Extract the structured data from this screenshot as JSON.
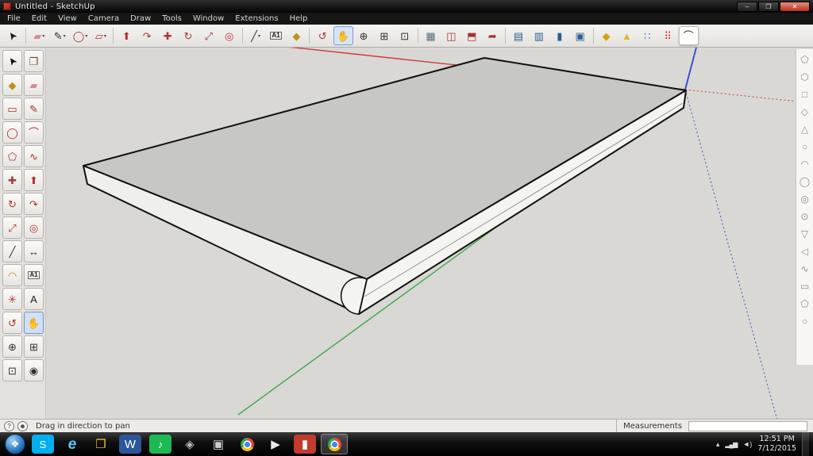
{
  "window": {
    "title": "Untitled - SketchUp",
    "minimize": "–",
    "maximize": "❐",
    "close": "✕"
  },
  "menu_bar": {
    "items": [
      {
        "name": "menu-file",
        "label": "File"
      },
      {
        "name": "menu-edit",
        "label": "Edit"
      },
      {
        "name": "menu-view",
        "label": "View"
      },
      {
        "name": "menu-camera",
        "label": "Camera"
      },
      {
        "name": "menu-draw",
        "label": "Draw"
      },
      {
        "name": "menu-tools",
        "label": "Tools"
      },
      {
        "name": "menu-window",
        "label": "Window"
      },
      {
        "name": "menu-extensions",
        "label": "Extensions"
      },
      {
        "name": "menu-help",
        "label": "Help"
      }
    ]
  },
  "top_toolbar": {
    "items": [
      {
        "name": "select-tool",
        "glyph": "➤",
        "color": "#1a1a1a",
        "cls": "rot-nw"
      },
      {
        "name": "toolbar-separator",
        "cls": "sep",
        "interactable": false
      },
      {
        "name": "eraser-tool",
        "glyph": "▰",
        "color": "#cf8d8d",
        "caret": "▾"
      },
      {
        "name": "line-tool",
        "glyph": "✎",
        "color": "#333333",
        "caret": "▾"
      },
      {
        "name": "shapes-tool",
        "glyph": "◯",
        "color": "#a63232",
        "caret": "▾"
      },
      {
        "name": "rotated-rectangle-tool",
        "glyph": "▱",
        "color": "#a63232",
        "caret": "▾"
      },
      {
        "name": "toolbar-separator",
        "cls": "sep",
        "interactable": false
      },
      {
        "name": "push-pull-tool",
        "glyph": "⬆",
        "color": "#b03434"
      },
      {
        "name": "follow-me-tool",
        "glyph": "↷",
        "color": "#b03434"
      },
      {
        "name": "move-tool",
        "glyph": "✚",
        "color": "#b03434"
      },
      {
        "name": "rotate-tool",
        "glyph": "↻",
        "color": "#b03434"
      },
      {
        "name": "scale-tool",
        "glyph": "⤢",
        "color": "#b03434"
      },
      {
        "name": "offset-tool",
        "glyph": "◎",
        "color": "#b03434"
      },
      {
        "name": "toolbar-separator",
        "cls": "sep",
        "interactable": false
      },
      {
        "name": "tape-measure-tool",
        "glyph": "╱",
        "color": "#333333",
        "caret": "▾"
      },
      {
        "name": "text-tool",
        "glyph": "A1",
        "color": "#222222",
        "cls": "small-text"
      },
      {
        "name": "paint-bucket-tool",
        "glyph": "◆",
        "color": "#c09020"
      },
      {
        "name": "toolbar-separator",
        "cls": "sep",
        "interactable": false
      },
      {
        "name": "orbit-tool",
        "glyph": "↺",
        "color": "#b03434"
      },
      {
        "name": "pan-tool",
        "glyph": "✋",
        "color": "#bf9268",
        "selected": true
      },
      {
        "name": "zoom-tool",
        "glyph": "⊕",
        "color": "#333333"
      },
      {
        "name": "zoom-window-tool",
        "glyph": "⊞",
        "color": "#333333"
      },
      {
        "name": "zoom-extents-tool",
        "glyph": "⊡",
        "color": "#333333"
      },
      {
        "name": "toolbar-separator",
        "cls": "sep",
        "interactable": false
      },
      {
        "name": "section-plane-tool",
        "glyph": "▦",
        "color": "#5a6b7a"
      },
      {
        "name": "section-display-toggle",
        "glyph": "◫",
        "color": "#a63232"
      },
      {
        "name": "section-cut-toggle",
        "glyph": "⬒",
        "color": "#a63232"
      },
      {
        "name": "export-scene-button",
        "glyph": "➦",
        "color": "#a63232"
      },
      {
        "name": "toolbar-separator",
        "cls": "sep",
        "interactable": false
      },
      {
        "name": "style-wireframe-button",
        "glyph": "▤",
        "color": "#2b5f8f"
      },
      {
        "name": "style-hidden-line-button",
        "glyph": "▥",
        "color": "#2b5f8f"
      },
      {
        "name": "style-shaded-button",
        "glyph": "▮",
        "color": "#2b5f8f"
      },
      {
        "name": "style-textured-button",
        "glyph": "▣",
        "color": "#2b5f8f"
      },
      {
        "name": "toolbar-separator",
        "cls": "sep",
        "interactable": false
      },
      {
        "name": "shadows-toggle",
        "glyph": "◆",
        "color": "#d4a017"
      },
      {
        "name": "fog-toggle",
        "glyph": "▲",
        "color": "#e0b52a"
      },
      {
        "name": "components-browser-button",
        "glyph": "∷",
        "color": "#3367d6"
      },
      {
        "name": "colors-browser-button",
        "glyph": "⠿",
        "color": "#d63333"
      },
      {
        "name": "two-point-arc-tool",
        "glyph": "⌒",
        "color": "#333333",
        "cls": "float-tool"
      }
    ]
  },
  "left_toolbar": {
    "items": [
      {
        "name": "select-tool",
        "glyph": "➤",
        "color": "#111111",
        "cls": "rot-nw"
      },
      {
        "name": "make-component-tool",
        "glyph": "❐",
        "color": "#6b4a2a"
      },
      {
        "name": "paint-bucket-tool",
        "glyph": "◆",
        "color": "#c09020"
      },
      {
        "name": "eraser-tool",
        "glyph": "▰",
        "color": "#cf8d8d"
      },
      {
        "name": "rectangle-tool",
        "glyph": "▭",
        "color": "#a63232"
      },
      {
        "name": "line-tool",
        "glyph": "✎",
        "color": "#a63232"
      },
      {
        "name": "circle-tool",
        "glyph": "◯",
        "color": "#a63232"
      },
      {
        "name": "arc-tool",
        "glyph": "⌒",
        "color": "#a63232"
      },
      {
        "name": "polygon-tool",
        "glyph": "⬠",
        "color": "#a63232"
      },
      {
        "name": "freehand-tool",
        "glyph": "∿",
        "color": "#a63232"
      },
      {
        "name": "move-tool",
        "glyph": "✚",
        "color": "#b03434"
      },
      {
        "name": "push-pull-tool",
        "glyph": "⬆",
        "color": "#b03434"
      },
      {
        "name": "rotate-tool",
        "glyph": "↻",
        "color": "#b03434"
      },
      {
        "name": "follow-me-tool",
        "glyph": "↷",
        "color": "#b03434"
      },
      {
        "name": "scale-tool",
        "glyph": "⤢",
        "color": "#b03434"
      },
      {
        "name": "offset-tool",
        "glyph": "◎",
        "color": "#b03434"
      },
      {
        "name": "tape-measure-tool",
        "glyph": "╱",
        "color": "#333333"
      },
      {
        "name": "dimension-tool",
        "glyph": "↔",
        "color": "#333333"
      },
      {
        "name": "protractor-tool",
        "glyph": "◠",
        "color": "#c09020"
      },
      {
        "name": "text-tool",
        "glyph": "A1",
        "color": "#222222",
        "cls": "small-text"
      },
      {
        "name": "axes-tool",
        "glyph": "✳",
        "color": "#b03434"
      },
      {
        "name": "3d-text-tool",
        "glyph": "A",
        "color": "#222222"
      },
      {
        "name": "orbit-tool",
        "glyph": "↺",
        "color": "#b03434"
      },
      {
        "name": "pan-tool",
        "glyph": "✋",
        "color": "#bf9268",
        "selected": true
      },
      {
        "name": "zoom-tool",
        "glyph": "⊕",
        "color": "#333333"
      },
      {
        "name": "zoom-window-tool",
        "glyph": "⊞",
        "color": "#333333"
      },
      {
        "name": "zoom-extents-tool",
        "glyph": "⊡",
        "color": "#333333"
      },
      {
        "name": "look-around-tool",
        "glyph": "◉",
        "color": "#333333"
      }
    ]
  },
  "right_toolbar": {
    "items": [
      {
        "name": "shape-pentagon-icon",
        "glyph": "⬠",
        "color": "#90908c"
      },
      {
        "name": "shape-hexagon-icon",
        "glyph": "⬡",
        "color": "#90908c"
      },
      {
        "name": "shape-cube-icon",
        "glyph": "□",
        "color": "#90908c"
      },
      {
        "name": "shape-prism-icon",
        "glyph": "◇",
        "color": "#90908c"
      },
      {
        "name": "shape-cone-icon",
        "glyph": "△",
        "color": "#90908c"
      },
      {
        "name": "shape-sphere-icon",
        "glyph": "○",
        "color": "#90908c"
      },
      {
        "name": "shape-dome-icon",
        "glyph": "◠",
        "color": "#90908c"
      },
      {
        "name": "shape-cylinder-icon",
        "glyph": "◯",
        "color": "#90908c"
      },
      {
        "name": "shape-torus-icon",
        "glyph": "◎",
        "color": "#90908c"
      },
      {
        "name": "shape-tube-icon",
        "glyph": "⊙",
        "color": "#90908c"
      },
      {
        "name": "shape-pyramid-icon",
        "glyph": "▽",
        "color": "#90908c"
      },
      {
        "name": "shape-wedge-icon",
        "glyph": "◁",
        "color": "#90908c"
      },
      {
        "name": "shape-helix-icon",
        "glyph": "∿",
        "color": "#90908c"
      },
      {
        "name": "shape-box-icon",
        "glyph": "▭",
        "color": "#90908c"
      },
      {
        "name": "shape-polygon-icon",
        "glyph": "⬠",
        "color": "#90908c"
      },
      {
        "name": "shape-ellipse-icon",
        "glyph": "○",
        "color": "#90908c"
      }
    ]
  },
  "viewport": {
    "axis_colors": {
      "red": "#cf3a3a",
      "green": "#3fa74a",
      "blue": "#3953c9"
    },
    "model": {
      "top_face_color": "#c7c7c3",
      "front_face_color": "#f4f4f1",
      "left_face_color": "#efefec"
    }
  },
  "status_bar": {
    "help": "?",
    "user": "☻",
    "hint": "Drag in direction to pan",
    "measurements_label": "Measurements",
    "measurements_value": ""
  },
  "taskbar": {
    "start": "❖",
    "apps": [
      {
        "name": "taskbar-app-skype",
        "glyph": "S",
        "bg": "#00aff0",
        "color": "#ffffff",
        "cls": "round"
      },
      {
        "name": "taskbar-app-internet-explorer",
        "glyph": "e",
        "color": "#5fc8f5",
        "cls": "app-ie"
      },
      {
        "name": "taskbar-app-file-explorer",
        "glyph": "❐",
        "color": "#f7c64a"
      },
      {
        "name": "taskbar-app-word",
        "glyph": "W",
        "bg": "#2b579a",
        "color": "#ffffff"
      },
      {
        "name": "taskbar-app-spotify",
        "glyph": "♪",
        "bg": "#1db954",
        "color": "#ffffff",
        "cls": "round"
      },
      {
        "name": "taskbar-app-screenshot-tool",
        "glyph": "◈",
        "color": "#b9b9b9"
      },
      {
        "name": "taskbar-app-media-player",
        "glyph": "▣",
        "color": "#cfcfcf"
      },
      {
        "name": "taskbar-app-chrome",
        "glyph": "",
        "cls": "app-chrome"
      },
      {
        "name": "taskbar-app-video-player",
        "glyph": "▶",
        "color": "#e8e8e8"
      },
      {
        "name": "taskbar-app-photo-viewer",
        "glyph": "▮",
        "bg": "#c13b2e",
        "color": "#ffffff"
      },
      {
        "name": "taskbar-app-chrome-active",
        "glyph": "",
        "cls": "app-chrome active"
      }
    ],
    "tray": {
      "overflow": "▴",
      "network": "▂▄▆",
      "volume": "◄)",
      "time": "12:51 PM",
      "date": "7/12/2015"
    }
  }
}
